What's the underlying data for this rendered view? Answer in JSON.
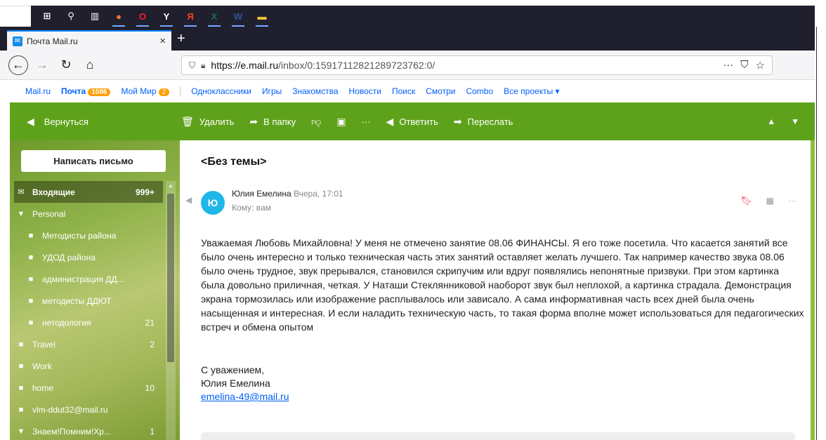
{
  "taskbar": {
    "icons": [
      {
        "name": "windows-start-icon",
        "glyph": "⊞"
      },
      {
        "name": "search-icon",
        "glyph": "⚲"
      },
      {
        "name": "task-view-icon",
        "glyph": "▥"
      },
      {
        "name": "firefox-icon",
        "glyph": "●"
      },
      {
        "name": "opera-icon",
        "glyph": "O"
      },
      {
        "name": "yandex-browser-icon",
        "glyph": "Y"
      },
      {
        "name": "yandex-icon",
        "glyph": "Я"
      },
      {
        "name": "excel-icon",
        "glyph": "X"
      },
      {
        "name": "word-icon",
        "glyph": "W"
      },
      {
        "name": "file-explorer-icon",
        "glyph": "▬"
      }
    ]
  },
  "browser": {
    "tab_title": "Почта Mail.ru",
    "tab_close": "×",
    "new_tab": "+",
    "url_domain": "https://e.mail.ru",
    "url_path": "/inbox/0:15917112821289723762:0/",
    "url_actions": [
      "···",
      "⛉",
      "☆"
    ]
  },
  "portal": {
    "links": [
      {
        "label": "Mail.ru",
        "strong": false
      },
      {
        "label": "Почта",
        "strong": true,
        "badge": "1086"
      },
      {
        "label": "Мой Мир",
        "strong": false,
        "badge": "2"
      },
      {
        "label": "Одноклассники",
        "strong": false
      },
      {
        "label": "Игры",
        "strong": false
      },
      {
        "label": "Знакомства",
        "strong": false
      },
      {
        "label": "Новости",
        "strong": false
      },
      {
        "label": "Поиск",
        "strong": false
      },
      {
        "label": "Смотри",
        "strong": false
      },
      {
        "label": "Combo",
        "strong": false
      },
      {
        "label": "Все проекты ▾",
        "strong": false
      }
    ]
  },
  "toolbar": {
    "back": "Вернуться",
    "delete": "Удалить",
    "move": "В папку",
    "more": "···",
    "reply": "Ответить",
    "forward": "Переслать"
  },
  "sidebar": {
    "compose": "Написать письмо",
    "folders": [
      {
        "label": "Входящие",
        "count": "999+",
        "icon": "✉",
        "active": true,
        "sub": false
      },
      {
        "label": "Personal",
        "count": "",
        "icon": "▼",
        "active": false,
        "sub": false
      },
      {
        "label": "Методисты района",
        "count": "",
        "icon": "■",
        "active": false,
        "sub": true
      },
      {
        "label": "УДОД района",
        "count": "",
        "icon": "■",
        "active": false,
        "sub": true
      },
      {
        "label": "администрация ДД...",
        "count": "",
        "icon": "■",
        "active": false,
        "sub": true
      },
      {
        "label": "методисты ДДЮТ",
        "count": "",
        "icon": "■",
        "active": false,
        "sub": true
      },
      {
        "label": "нетодология",
        "count": "21",
        "icon": "■",
        "active": false,
        "sub": true
      },
      {
        "label": "Travel",
        "count": "2",
        "icon": "■",
        "active": false,
        "sub": false
      },
      {
        "label": "Work",
        "count": "",
        "icon": "■",
        "active": false,
        "sub": false
      },
      {
        "label": "home",
        "count": "10",
        "icon": "■",
        "active": false,
        "sub": false
      },
      {
        "label": "vlm-ddut32@mail.ru",
        "count": "",
        "icon": "■",
        "active": false,
        "sub": false
      },
      {
        "label": "Знаем!Помним!Хр...",
        "count": "1",
        "icon": "▼",
        "active": false,
        "sub": false
      }
    ]
  },
  "message": {
    "subject": "<Без темы>",
    "avatar_letter": "Ю",
    "sender_name": "Юлия Емелина",
    "date": "Вчера, 17:01",
    "to": "Кому: вам",
    "body": "Уважаемая Любовь Михайловна! У меня не отмечено занятие 08.06  ФИНАНСЫ. Я его тоже посетила. Что касается занятий все было очень интересно и только техническая часть этих занятий оставляет желать лучшего. Так например качество звука 08.06 было очень трудное, звук прерывался, становился скрипучим или вдруг появлялись непонятные призвуки. При этом картинка была довольно приличная, четкая. У Наташи Стеклянниковой наоборот звук был неплохой, а картинка страдала. Демонстрация экрана тормозилась или изображение расплывалось или зависало. А сама информативная часть всех дней была очень насыщенная и интересная. И если наладить техническую часть, то такая форма вполне может использоваться для педагогических встреч и обмена опытом",
    "sign_line1": "С уважением,",
    "sign_line2": "Юлия Емелина",
    "sign_email": "emelina-49@mail.ru"
  },
  "colors": {
    "accent_green": "#5ea21b",
    "link_blue": "#005ff9",
    "badge_orange": "#ff9e00",
    "avatar_blue": "#1fb7e8",
    "flag_red": "#ee1e3c"
  }
}
